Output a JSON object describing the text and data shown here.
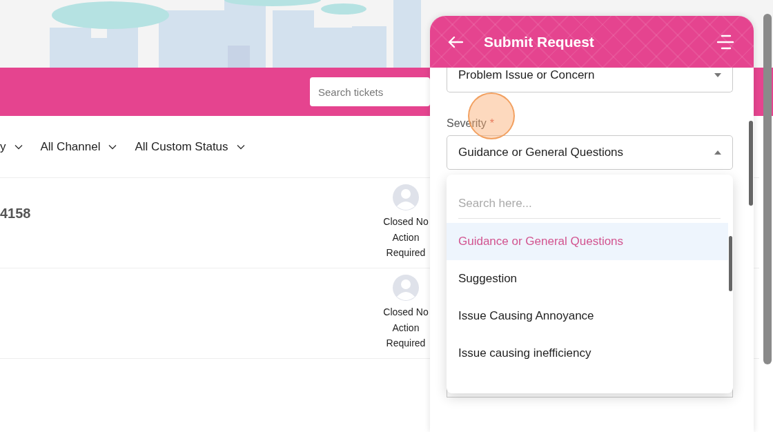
{
  "search": {
    "placeholder": "Search tickets"
  },
  "filters": [
    {
      "label": "y"
    },
    {
      "label": "All Channel"
    },
    {
      "label": "All Custom Status"
    }
  ],
  "tickets": [
    {
      "number": "4158",
      "status": "Closed No Action Required"
    },
    {
      "status": "Closed No Action Required"
    }
  ],
  "panel": {
    "title": "Submit Request",
    "fields": [
      {
        "value": "Problem Issue or Concern",
        "expanded": false
      },
      {
        "label": "Severity",
        "required_mark": "*",
        "value": "Guidance or General Questions",
        "expanded": true
      }
    ],
    "dropdown": {
      "placeholder": "Search here...",
      "options": [
        {
          "label": "Guidance or General Questions",
          "selected": true
        },
        {
          "label": "Suggestion",
          "selected": false
        },
        {
          "label": "Issue Causing Annoyance",
          "selected": false
        },
        {
          "label": "Issue causing inefficiency",
          "selected": false
        }
      ]
    }
  }
}
